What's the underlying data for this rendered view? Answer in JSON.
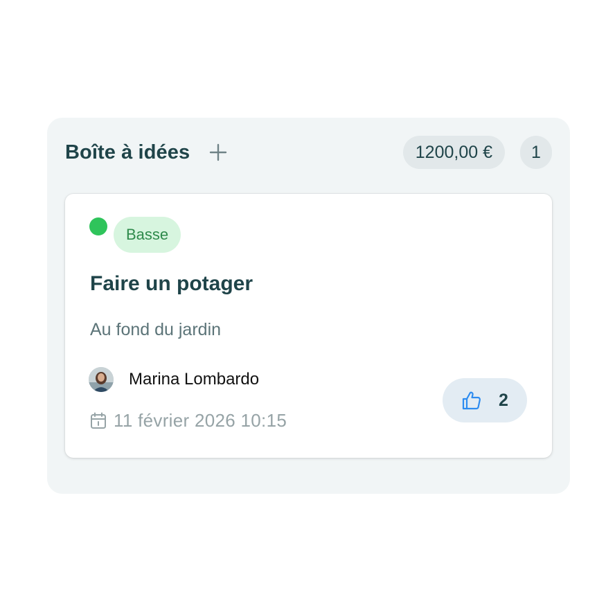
{
  "column": {
    "title": "Boîte à idées",
    "add_icon": "plus-icon",
    "total_amount": "1200,00 €",
    "card_count": "1"
  },
  "card": {
    "status_color": "#2fc45b",
    "priority": "Basse",
    "title": "Faire un potager",
    "description": "Au fond du jardin",
    "author": "Marina Lombardo",
    "date_icon": "calendar-icon",
    "date": "11 février 2026 10:15",
    "like_icon": "thumbs-up-icon",
    "likes": "2"
  },
  "colors": {
    "accent": "#1f4449",
    "like_icon": "#2d8cf0",
    "priority_bg": "#d7f5df",
    "priority_text": "#2e8a4b"
  }
}
